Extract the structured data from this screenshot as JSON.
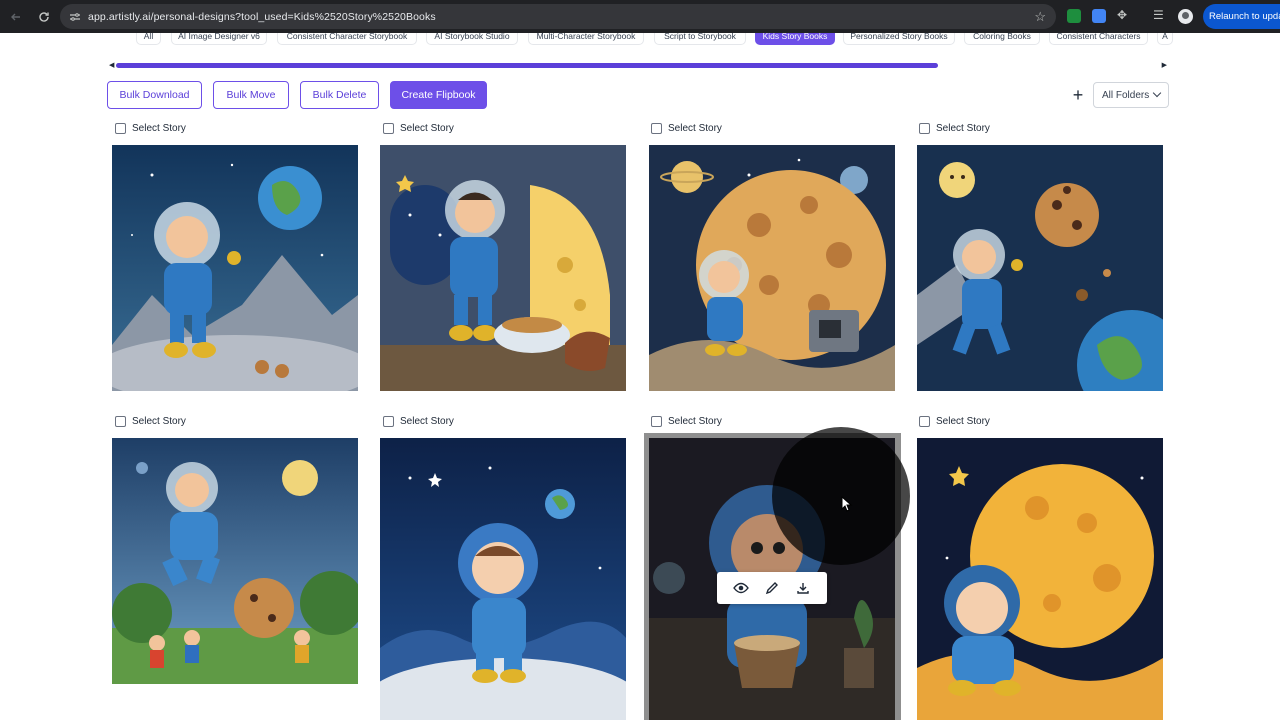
{
  "browser": {
    "url": "app.artistly.ai/personal-designs?tool_used=Kids%2520Story%2520Books",
    "relaunch_label": "Relaunch to update"
  },
  "tabs": [
    {
      "label": "All",
      "active": false
    },
    {
      "label": "AI Image Designer v6",
      "active": false
    },
    {
      "label": "Consistent Character Storybook",
      "active": false
    },
    {
      "label": "AI Storybook Studio",
      "active": false
    },
    {
      "label": "Multi-Character Storybook",
      "active": false
    },
    {
      "label": "Script to Storybook",
      "active": false
    },
    {
      "label": "Kids Story Books",
      "active": true
    },
    {
      "label": "Personalized Story Books",
      "active": false
    },
    {
      "label": "Coloring Books",
      "active": false
    },
    {
      "label": "Consistent Characters",
      "active": false
    },
    {
      "label": "A",
      "active": false
    }
  ],
  "toolbar": {
    "bulk_download": "Bulk Download",
    "bulk_move": "Bulk Move",
    "bulk_delete": "Bulk Delete",
    "create_flipbook": "Create Flipbook",
    "folders_select": "All Folders"
  },
  "cards": [
    {
      "select_label": "Select Story",
      "scene": "astronaut on moon waving at earth with cookies"
    },
    {
      "select_label": "Select Story",
      "scene": "astronaut eating cookies in cheese doorway"
    },
    {
      "select_label": "Select Story",
      "scene": "astronaut beside giant cookie planet with oven"
    },
    {
      "select_label": "Select Story",
      "scene": "astronaut floating with bitten cookie and earth"
    },
    {
      "select_label": "Select Story",
      "scene": "astronaut flying over children with cookie in park"
    },
    {
      "select_label": "Select Story",
      "scene": "young astronaut on moon under starry sky"
    },
    {
      "select_label": "Select Story",
      "scene": "astronaut mixing dough in dark kitchen"
    },
    {
      "select_label": "Select Story",
      "scene": "astronaut sitting in front of yellow moon"
    }
  ],
  "hover_actions": [
    "eye-icon",
    "pencil-icon",
    "download-icon"
  ],
  "colors": {
    "accent": "#6d4fe8",
    "scrollbar": "#5b3fd9"
  }
}
